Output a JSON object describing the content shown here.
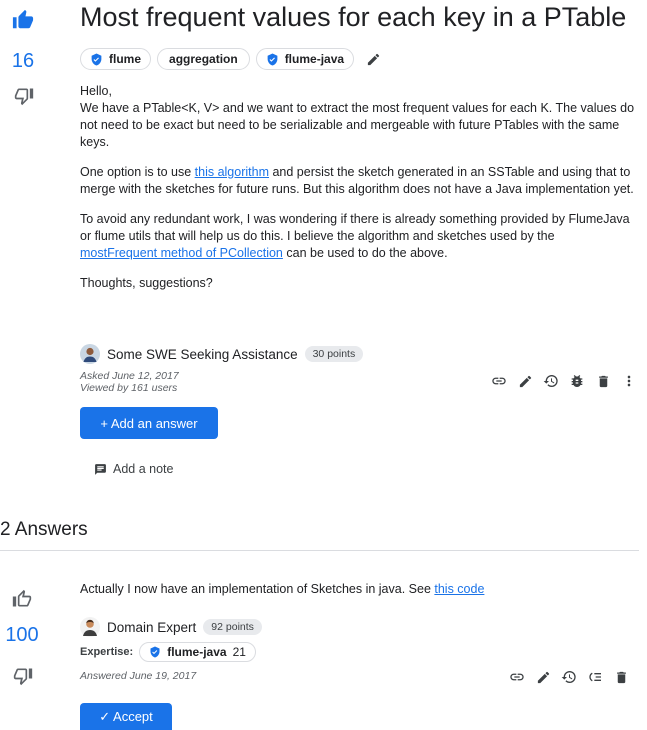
{
  "question": {
    "title": "Most frequent values for each key in a PTable",
    "votes": "16",
    "tags": [
      {
        "label": "flume",
        "verified": true
      },
      {
        "label": "aggregation",
        "verified": false
      },
      {
        "label": "flume-java",
        "verified": true
      }
    ],
    "body": {
      "p1_line1": "Hello,",
      "p1_line2": "We have a PTable<K, V> and we want to extract the most frequent values for each K. The values do not need to be exact but need to be serializable and mergeable with future PTables with the same keys.",
      "p2_before": "One option is to use ",
      "p2_link": "this algorithm",
      "p2_after": " and persist the sketch generated in an SSTable and using that to merge with the sketches for future runs. But this algorithm does not have a Java implementation yet.",
      "p3_before": "To avoid any redundant work, I was wondering if there is already something provided by FlumeJava or flume utils that will help us do this. I believe the algorithm and sketches used by the",
      "p3_link": " mostFrequent method of PCollection",
      "p3_after": " can be used to do the above.",
      "p4": "Thoughts, suggestions?"
    },
    "author": {
      "name": "Some SWE Seeking Assistance",
      "points": "30 points"
    },
    "asked": "Asked June 12, 2017",
    "viewed": "Viewed by 161 users",
    "add_answer_label": "+ Add an answer",
    "add_note_label": "Add a note"
  },
  "answers_heading": "2 Answers",
  "answer": {
    "votes": "100",
    "body_before": "Actually I now have an implementation of Sketches in java. See ",
    "body_link": "this code",
    "author": {
      "name": "Domain Expert",
      "points": "92 points"
    },
    "expertise_label": "Expertise:",
    "expertise_tag": "flume-java",
    "expertise_count": "21",
    "answered": "Answered June 19, 2017",
    "accept_label": "✓ Accept"
  },
  "colors": {
    "accent": "#1a73e8",
    "text": "#202124",
    "muted": "#5f6368"
  }
}
